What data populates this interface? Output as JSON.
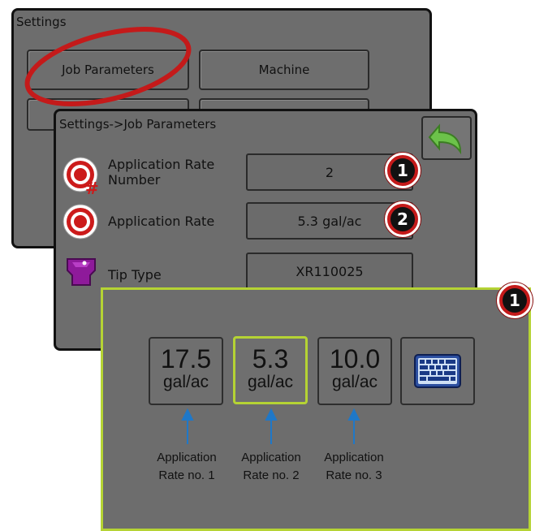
{
  "settings_screen": {
    "title": "Settings",
    "buttons": [
      {
        "label": "Job Parameters"
      },
      {
        "label": "Machine"
      }
    ]
  },
  "job_params_screen": {
    "title": "Settings->Job Parameters",
    "rows": [
      {
        "label_line1": "Application Rate",
        "label_line2": "Number",
        "value": "2",
        "icon": "target-hash-icon"
      },
      {
        "label": "Application Rate",
        "value": "5.3 gal/ac",
        "icon": "target-icon"
      },
      {
        "label": "Tip Type",
        "value": "XR110025",
        "icon": "nozzle-tip-icon"
      }
    ],
    "back_icon": "back-arrow-icon"
  },
  "callouts": {
    "one": "1",
    "two": "2"
  },
  "rate_popup": {
    "rates": [
      {
        "value": "17.5",
        "unit": "gal/ac",
        "caption_line1": "Application",
        "caption_line2": "Rate no. 1",
        "selected": false
      },
      {
        "value": "5.3",
        "unit": "gal/ac",
        "caption_line1": "Application",
        "caption_line2": "Rate no. 2",
        "selected": true
      },
      {
        "value": "10.0",
        "unit": "gal/ac",
        "caption_line1": "Application",
        "caption_line2": "Rate no. 3",
        "selected": false
      }
    ],
    "keyboard_icon": "keyboard-icon",
    "highlight_color": "#b5d334"
  },
  "annotation": {
    "highlight_ellipse_color": "#c41a1a",
    "arrow_color": "#1f78c8"
  }
}
